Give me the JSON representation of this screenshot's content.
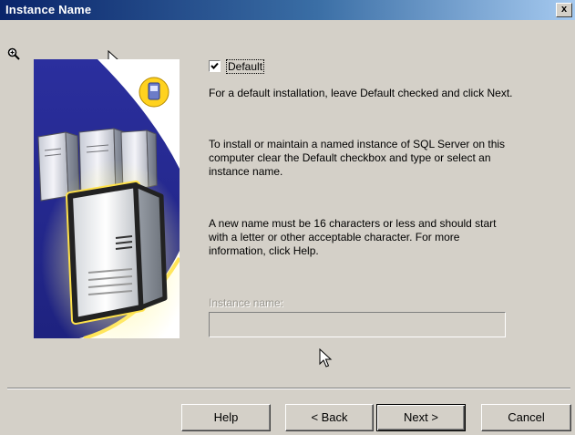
{
  "window": {
    "title": "Instance Name",
    "close_glyph": "x"
  },
  "default_checkbox": {
    "label": "Default",
    "checked": true
  },
  "paragraphs": {
    "p1": "For a default installation, leave Default checked and click Next.",
    "p2": "To install or maintain a named instance of SQL Server on this computer clear the Default checkbox and type or select an instance name.",
    "p3": "A new name must be 16 characters or less and should start with a letter or other acceptable character.  For more information, click Help."
  },
  "instance_name": {
    "label": "Instance name:",
    "value": ""
  },
  "buttons": {
    "help": "Help",
    "back": "< Back",
    "next": "Next >",
    "cancel": "Cancel"
  },
  "colors": {
    "dialog_bg": "#d4d0c8",
    "titlebar_start": "#0a246a",
    "titlebar_end": "#a6caf0",
    "disabled_text": "#9a978f"
  },
  "icons": [
    "magnifier-icon",
    "arrow-cursor-icon",
    "server-illustration",
    "lock-badge-icon"
  ]
}
